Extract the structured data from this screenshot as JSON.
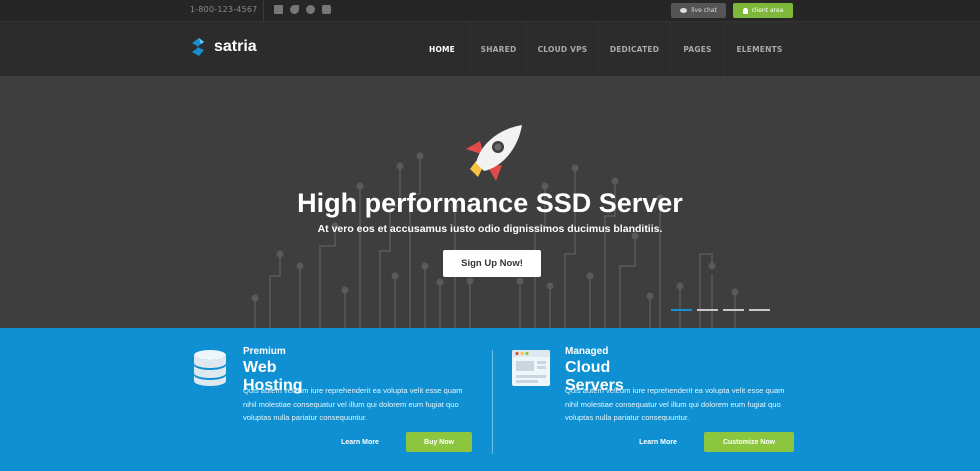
{
  "topbar": {
    "phone": "1-800-123-4567",
    "socials": [
      "facebook-icon",
      "twitter-icon",
      "google-plus-icon",
      "youtube-icon"
    ],
    "chat_label": "live chat",
    "client_label": "client area"
  },
  "brand": {
    "name": "satria",
    "accent": "#1a8fd1"
  },
  "nav": {
    "items": [
      "HOME",
      "SHARED",
      "CLOUD VPS",
      "DEDICATED",
      "PAGES",
      "ELEMENTS"
    ],
    "active": "HOME"
  },
  "hero": {
    "title": "High performance SSD Server",
    "subtitle": "At vero eos et accusamus iusto odio dignissimos ducimus blanditiis.",
    "cta": "Sign Up Now!",
    "slides": 4,
    "active_slide": 1
  },
  "features": [
    {
      "kicker": "Premium",
      "title": "Web Hosting",
      "text": "Quis autem veleum iure reprehenderit ea volupta velit esse quam nihil molestiae consequatur vel illum qui dolorem eum fugiat quo voluptas nulla pariatur consequuntur.",
      "more": "Learn More",
      "action": "Buy Now"
    },
    {
      "kicker": "Managed",
      "title": "Cloud Servers",
      "text": "Quis autem veleum iure reprehenderit ea volupta velit esse quam nihil molestiae consequatur vel illum qui dolorem eum fugiat quo voluptas nulla pariatur consequuntur.",
      "more": "Learn More",
      "action": "Customize Now"
    }
  ],
  "colors": {
    "top_bg": "#262626",
    "nav_bg": "#2c2c2c",
    "hero_bg": "#3e3e3e",
    "features_bg": "#0e90d2",
    "green": "#8cc63f"
  }
}
